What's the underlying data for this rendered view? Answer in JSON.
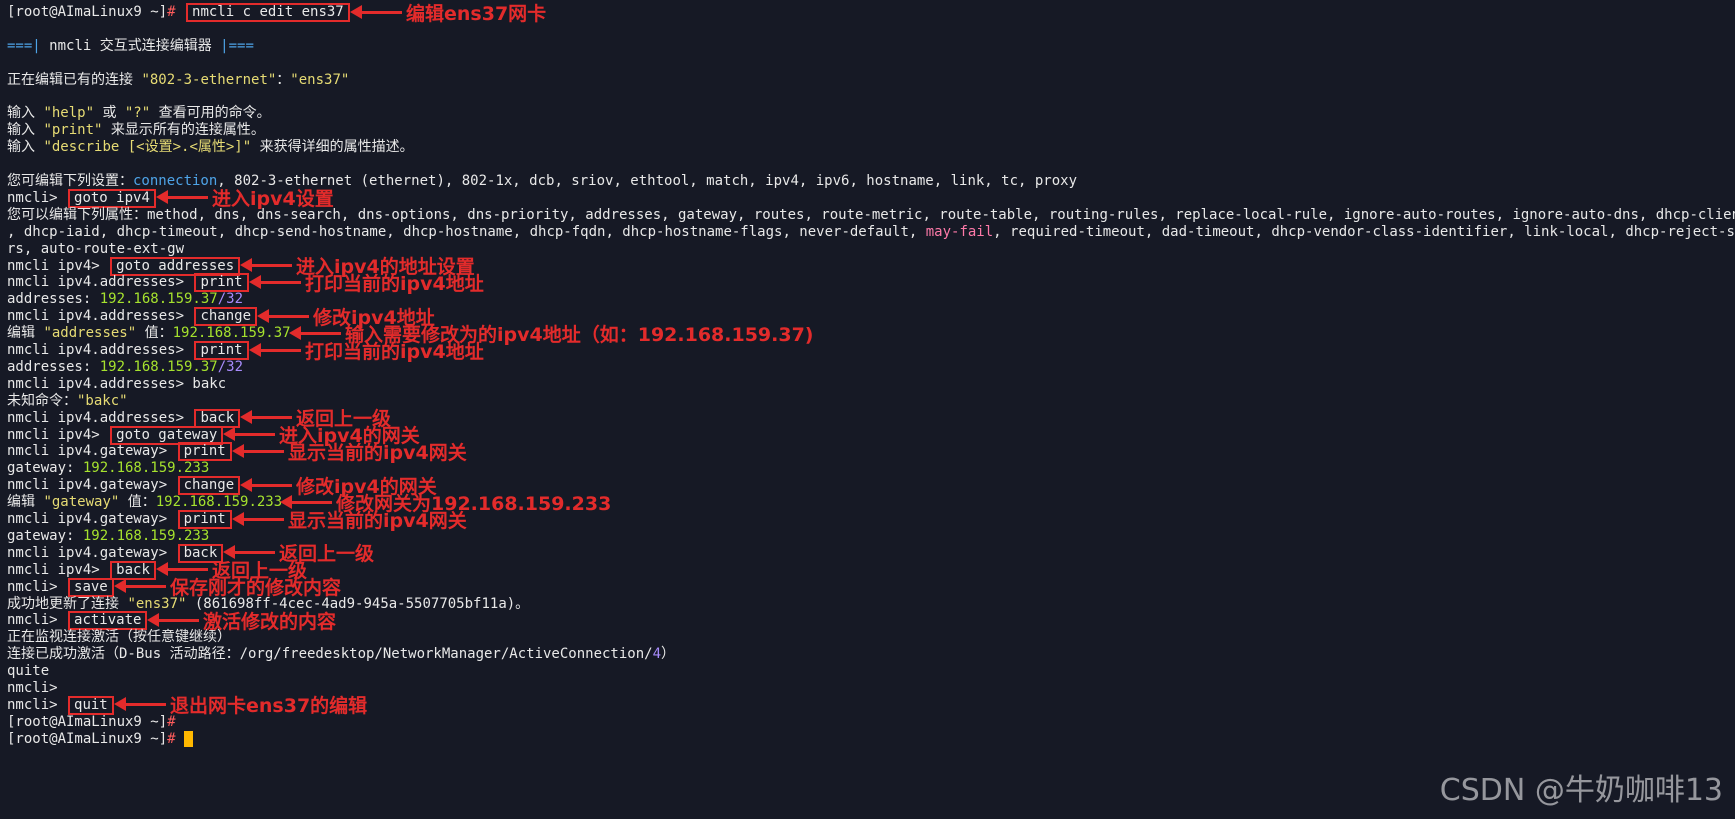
{
  "terminal": {
    "lines": [
      [
        {
          "t": "[root@AImaLinux9 ~]",
          "c": "w"
        },
        {
          "t": "# ",
          "c": "r"
        },
        {
          "t": "nmcli c edit ens37",
          "c": "w",
          "box": true
        }
      ],
      [],
      [
        {
          "t": "===| ",
          "c": "b"
        },
        {
          "t": "nmcli 交互式连接编辑器",
          "c": "w"
        },
        {
          "t": " |===",
          "c": "b"
        }
      ],
      [],
      [
        {
          "t": "正在编辑已有的连接 ",
          "c": "w"
        },
        {
          "t": "\"802-3-ethernet\"",
          "c": "y"
        },
        {
          "t": "：",
          "c": "w"
        },
        {
          "t": "\"ens37\"",
          "c": "y"
        }
      ],
      [],
      [
        {
          "t": "输入 ",
          "c": "w"
        },
        {
          "t": "\"help\"",
          "c": "y"
        },
        {
          "t": " 或 ",
          "c": "w"
        },
        {
          "t": "\"?\"",
          "c": "y"
        },
        {
          "t": " 查看可用的命令。",
          "c": "w"
        }
      ],
      [
        {
          "t": "输入 ",
          "c": "w"
        },
        {
          "t": "\"print\"",
          "c": "y"
        },
        {
          "t": " 来显示所有的连接属性。",
          "c": "w"
        }
      ],
      [
        {
          "t": "输入 ",
          "c": "w"
        },
        {
          "t": "\"describe [<设置>.<属性>]\"",
          "c": "y"
        },
        {
          "t": " 来获得详细的属性描述。",
          "c": "w"
        }
      ],
      [],
      [
        {
          "t": "您可编辑下列设置：",
          "c": "w"
        },
        {
          "t": "connection",
          "c": "b"
        },
        {
          "t": ", 802-3-ethernet (ethernet), 802-1x, dcb, sriov, ethtool, match, ipv4, ipv6, hostname, link, tc, proxy",
          "c": "w"
        }
      ],
      [
        {
          "t": "nmcli> ",
          "c": "w"
        },
        {
          "t": "goto ipv4",
          "c": "w",
          "box": true
        }
      ],
      [
        {
          "t": "您可以编辑下列属性：method, dns, dns-search, dns-options, dns-priority, addresses, gateway, routes, route-metric, route-table, routing-rules, replace-local-rule, ignore-auto-routes, ignore-auto-dns, dhcp-client-id",
          "c": "w"
        }
      ],
      [
        {
          "t": ", dhcp-iaid, dhcp-timeout, dhcp-send-hostname, dhcp-hostname, dhcp-fqdn, dhcp-hostname-flags, never-default, ",
          "c": "w"
        },
        {
          "t": "may-fail",
          "c": "h"
        },
        {
          "t": ", required-timeout, dad-timeout, dhcp-vendor-class-identifier, link-local, dhcp-reject-serve",
          "c": "w"
        }
      ],
      [
        {
          "t": "rs, auto-route-ext-gw",
          "c": "w"
        }
      ],
      [
        {
          "t": "nmcli ipv4> ",
          "c": "w"
        },
        {
          "t": "goto addresses",
          "c": "w",
          "box": true
        }
      ],
      [
        {
          "t": "nmcli ipv4.addresses> ",
          "c": "w"
        },
        {
          "t": "print",
          "c": "w",
          "box": true
        }
      ],
      [
        {
          "t": "addresses: ",
          "c": "w"
        },
        {
          "t": "192.168.159.37",
          "c": "g"
        },
        {
          "t": "/32",
          "c": "m"
        }
      ],
      [
        {
          "t": "nmcli ipv4.addresses> ",
          "c": "w"
        },
        {
          "t": "change",
          "c": "w",
          "box": true
        }
      ],
      [
        {
          "t": "编辑 ",
          "c": "w"
        },
        {
          "t": "\"addresses\"",
          "c": "y"
        },
        {
          "t": " 值：",
          "c": "w"
        },
        {
          "t": "192.168.159.37",
          "c": "g"
        }
      ],
      [
        {
          "t": "nmcli ipv4.addresses> ",
          "c": "w"
        },
        {
          "t": "print",
          "c": "w",
          "box": true
        }
      ],
      [
        {
          "t": "addresses: ",
          "c": "w"
        },
        {
          "t": "192.168.159.37",
          "c": "g"
        },
        {
          "t": "/32",
          "c": "m"
        }
      ],
      [
        {
          "t": "nmcli ipv4.addresses> bakc",
          "c": "w"
        }
      ],
      [
        {
          "t": "未知命令：",
          "c": "w"
        },
        {
          "t": "\"bakc\"",
          "c": "y"
        }
      ],
      [
        {
          "t": "nmcli ipv4.addresses> ",
          "c": "w"
        },
        {
          "t": "back",
          "c": "w",
          "box": true
        }
      ],
      [
        {
          "t": "nmcli ipv4> ",
          "c": "w"
        },
        {
          "t": "goto gateway",
          "c": "w",
          "box": true
        }
      ],
      [
        {
          "t": "nmcli ipv4.gateway> ",
          "c": "w"
        },
        {
          "t": "print",
          "c": "w",
          "box": true
        }
      ],
      [
        {
          "t": "gateway: ",
          "c": "w"
        },
        {
          "t": "192.168.159.233",
          "c": "g"
        }
      ],
      [
        {
          "t": "nmcli ipv4.gateway> ",
          "c": "w"
        },
        {
          "t": "change",
          "c": "w",
          "box": true
        }
      ],
      [
        {
          "t": "编辑 ",
          "c": "w"
        },
        {
          "t": "\"gateway\"",
          "c": "y"
        },
        {
          "t": " 值：",
          "c": "w"
        },
        {
          "t": "192.168.159.233",
          "c": "g"
        }
      ],
      [
        {
          "t": "nmcli ipv4.gateway> ",
          "c": "w"
        },
        {
          "t": "print",
          "c": "w",
          "box": true
        }
      ],
      [
        {
          "t": "gateway: ",
          "c": "w"
        },
        {
          "t": "192.168.159.233",
          "c": "g"
        }
      ],
      [
        {
          "t": "nmcli ipv4.gateway> ",
          "c": "w"
        },
        {
          "t": "back",
          "c": "w",
          "box": true
        }
      ],
      [
        {
          "t": "nmcli ipv4> ",
          "c": "w"
        },
        {
          "t": "back",
          "c": "w",
          "box": true
        }
      ],
      [
        {
          "t": "nmcli> ",
          "c": "w"
        },
        {
          "t": "save",
          "c": "w",
          "box": true
        }
      ],
      [
        {
          "t": "成功地更新了连接 ",
          "c": "w"
        },
        {
          "t": "\"ens37\"",
          "c": "y"
        },
        {
          "t": " (861698ff-4cec-4ad9-945a-5507705bf11a)。",
          "c": "w"
        }
      ],
      [
        {
          "t": "nmcli> ",
          "c": "w"
        },
        {
          "t": "activate",
          "c": "w",
          "box": true
        }
      ],
      [
        {
          "t": "正在监视连接激活（按任意键继续）",
          "c": "w"
        }
      ],
      [
        {
          "t": "连接已成功激活（D-Bus 活动路径：/org/freedesktop/NetworkManager/ActiveConnection/",
          "c": "w"
        },
        {
          "t": "4",
          "c": "m"
        },
        {
          "t": "）",
          "c": "w"
        }
      ],
      [
        {
          "t": "quite",
          "c": "w"
        }
      ],
      [
        {
          "t": "nmcli>",
          "c": "w"
        }
      ],
      [
        {
          "t": "nmcli> ",
          "c": "w"
        },
        {
          "t": "quit",
          "c": "w",
          "box": true
        }
      ],
      [
        {
          "t": "[root@AImaLinux9 ~]",
          "c": "w"
        },
        {
          "t": "#",
          "c": "r"
        }
      ],
      [
        {
          "t": "[root@AImaLinux9 ~]",
          "c": "w"
        },
        {
          "t": "# ",
          "c": "r"
        },
        {
          "t": "",
          "c": "w",
          "cursor": true
        }
      ]
    ]
  },
  "annotations": [
    {
      "line": 0,
      "text": "编辑ens37网卡"
    },
    {
      "line": 11,
      "text": "进入ipv4设置"
    },
    {
      "line": 15,
      "text": "进入ipv4的地址设置"
    },
    {
      "line": 16,
      "text": "打印当前的ipv4地址"
    },
    {
      "line": 18,
      "text": "修改ipv4地址"
    },
    {
      "line": 19,
      "text": "输入需要修改为的ipv4地址（如：192.168.159.37)"
    },
    {
      "line": 20,
      "text": "打印当前的ipv4地址"
    },
    {
      "line": 24,
      "text": "返回上一级"
    },
    {
      "line": 25,
      "text": "进入ipv4的网关"
    },
    {
      "line": 26,
      "text": "显示当前的ipv4网关"
    },
    {
      "line": 28,
      "text": "修改ipv4的网关"
    },
    {
      "line": 29,
      "text": "修改网关为192.168.159.233"
    },
    {
      "line": 30,
      "text": "显示当前的ipv4网关"
    },
    {
      "line": 32,
      "text": "返回上一级"
    },
    {
      "line": 33,
      "text": "返回上一级"
    },
    {
      "line": 34,
      "text": "保存刚才的修改内容"
    },
    {
      "line": 36,
      "text": "激活修改的内容"
    },
    {
      "line": 41,
      "text": "退出网卡ens37的编辑"
    }
  ],
  "watermark": "CSDN @牛奶咖啡13"
}
